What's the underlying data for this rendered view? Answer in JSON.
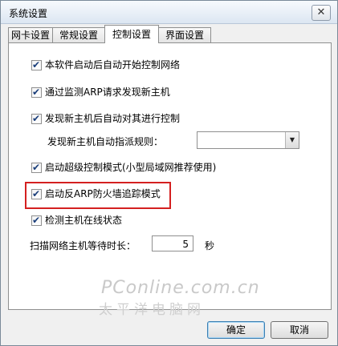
{
  "window": {
    "title": "系统设置",
    "close_glyph": "✕"
  },
  "tabs": [
    {
      "label": "网卡设置"
    },
    {
      "label": "常规设置"
    },
    {
      "label": "控制设置"
    },
    {
      "label": "界面设置"
    }
  ],
  "active_tab": "控制设置",
  "options": [
    {
      "label": "本软件启动后自动开始控制网络",
      "checked": true
    },
    {
      "label": "通过监测ARP请求发现新主机",
      "checked": true
    },
    {
      "label": "发现新主机后自动对其进行控制",
      "checked": true
    },
    {
      "label": "启动超级控制模式(小型局域网推荐使用)",
      "checked": true
    },
    {
      "label": "启动反ARP防火墙追踪模式",
      "checked": true
    },
    {
      "label": "检测主机在线状态",
      "checked": true
    }
  ],
  "check_glyph": "✔",
  "auto_rule": {
    "label": "发现新主机自动指派规则：",
    "value": "",
    "arrow": "▼"
  },
  "scan_wait": {
    "label": "扫描网络主机等待时长：",
    "value": "5",
    "unit": "秒"
  },
  "watermark": {
    "line1": "PConline.com.cn",
    "line2": "太平洋电脑网"
  },
  "buttons": {
    "ok": "确定",
    "cancel": "取消"
  }
}
